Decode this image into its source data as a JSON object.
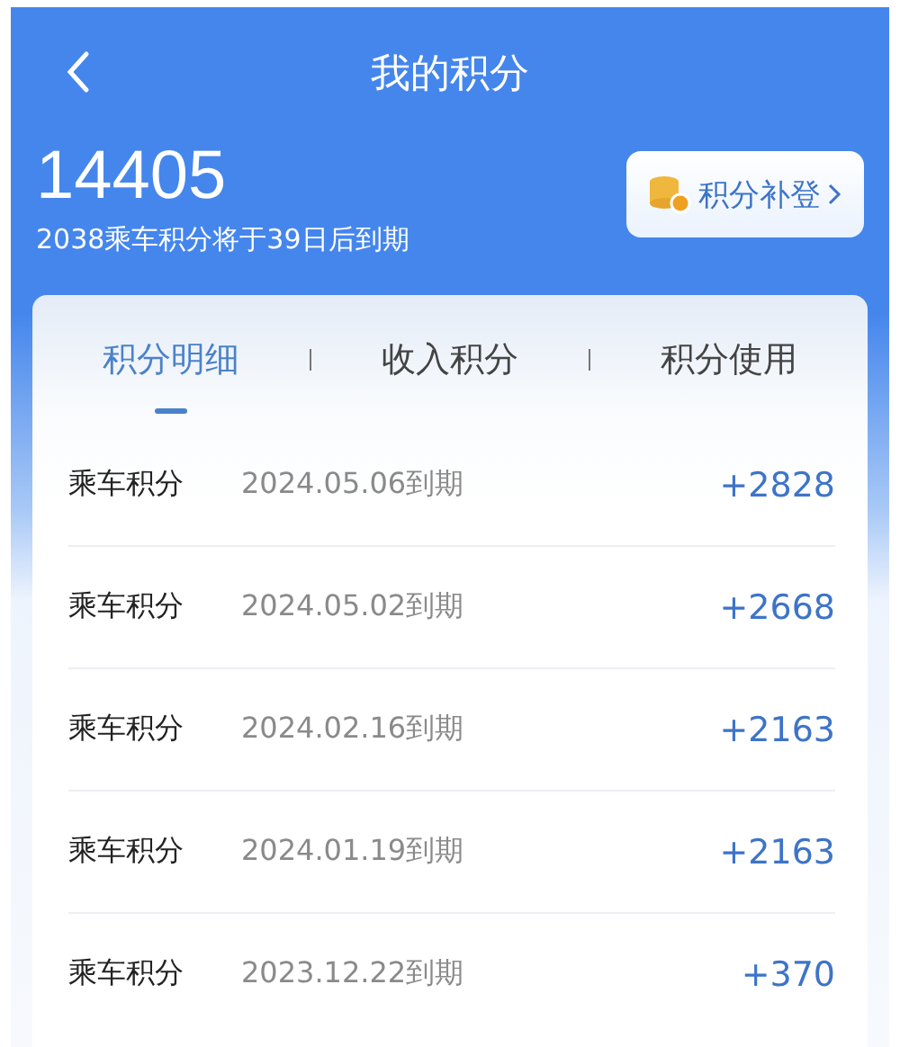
{
  "header": {
    "title": "我的积分"
  },
  "summary": {
    "total": "14405",
    "note": "2038乘车积分将于39日后到期",
    "action": "积分补登"
  },
  "tabs": [
    {
      "label": "积分明细",
      "selected": true
    },
    {
      "label": "收入积分",
      "selected": false
    },
    {
      "label": "积分使用",
      "selected": false
    }
  ],
  "rows": [
    {
      "type": "乘车积分",
      "expiry": "2024.05.06到期",
      "amount": "+2828"
    },
    {
      "type": "乘车积分",
      "expiry": "2024.05.02到期",
      "amount": "+2668"
    },
    {
      "type": "乘车积分",
      "expiry": "2024.02.16到期",
      "amount": "+2163"
    },
    {
      "type": "乘车积分",
      "expiry": "2024.01.19到期",
      "amount": "+2163"
    },
    {
      "type": "乘车积分",
      "expiry": "2023.12.22到期",
      "amount": "+370"
    }
  ]
}
